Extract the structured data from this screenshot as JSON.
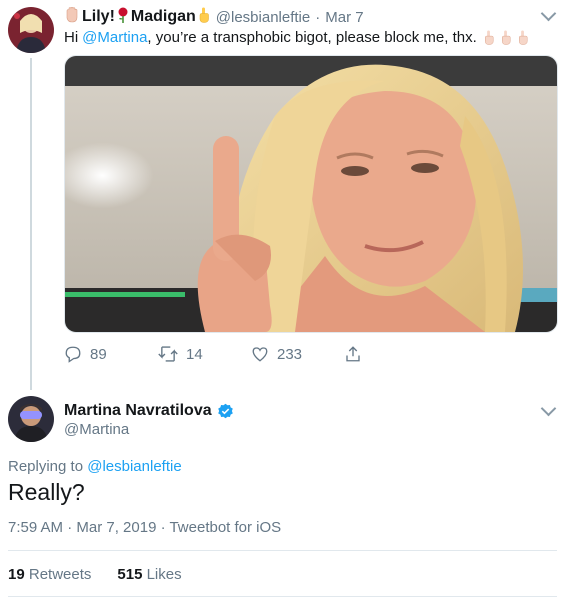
{
  "tweet1": {
    "name_part1": "Lily!",
    "name_part2": "Madigan",
    "handle": "@lesbianleftie",
    "sep": "·",
    "date": "Mar 7",
    "text_hi": "Hi",
    "mention": "@Martina",
    "text_rest": ", you’re a transphobic bigot, please block me, thx.",
    "replies": "89",
    "retweets": "14",
    "likes": "233"
  },
  "tweet2": {
    "name": "Martina Navratilova",
    "handle": "@Martina",
    "replying_prefix": "Replying to",
    "replying_to": "@lesbianleftie",
    "text": "Really?",
    "meta": "7:59 AM · Mar 7, 2019 · Tweetbot for iOS",
    "retweets_count": "19",
    "retweets_label": "Retweets",
    "likes_count": "515",
    "likes_label": "Likes"
  },
  "colors": {
    "accent": "#1da1f2",
    "muted": "#657786",
    "verified": "#1da1f2"
  }
}
